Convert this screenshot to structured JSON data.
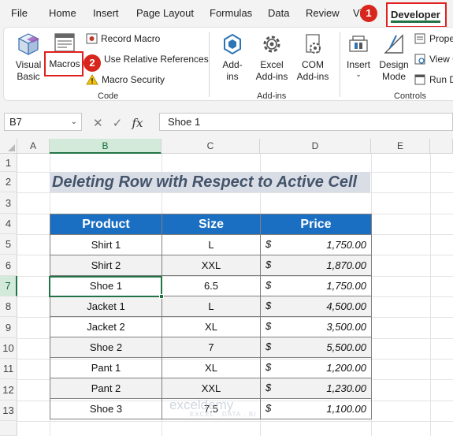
{
  "menu": {
    "tabs": [
      "File",
      "Home",
      "Insert",
      "Page Layout",
      "Formulas",
      "Data",
      "Review",
      "Vi"
    ],
    "developer": "Developer"
  },
  "ribbon": {
    "code": {
      "visual_basic": "Visual\nBasic",
      "macros": "Macros",
      "record_macro": "Record Macro",
      "use_relative": "Use Relative References",
      "macro_security": "Macro Security",
      "label": "Code"
    },
    "addins": {
      "addins": "Add-\nins",
      "excel_addins": "Excel\nAdd-ins",
      "com_addins": "COM\nAdd-ins",
      "label": "Add-ins"
    },
    "controls": {
      "insert": "Insert",
      "design_mode": "Design\nMode",
      "properties": "Prope",
      "view_code": "View C",
      "run_dialog": "Run D",
      "label": "Controls"
    }
  },
  "badges": {
    "one": "1",
    "two": "2"
  },
  "formula_bar": {
    "name_box": "B7",
    "fx": "fx",
    "formula": "Shoe 1"
  },
  "grid": {
    "columns": [
      "A",
      "B",
      "C",
      "D",
      "E"
    ],
    "rows": [
      "1",
      "2",
      "3",
      "4",
      "5",
      "6",
      "7",
      "8",
      "9",
      "10",
      "11",
      "12",
      "13"
    ]
  },
  "sheet": {
    "title": "Deleting Row with Respect to Active Cell",
    "headers": [
      "Product",
      "Size",
      "Price"
    ],
    "currency": "$",
    "rows": [
      {
        "product": "Shirt 1",
        "size": "L",
        "price": "1,750.00"
      },
      {
        "product": "Shirt 2",
        "size": "XXL",
        "price": "1,870.00"
      },
      {
        "product": "Shoe 1",
        "size": "6.5",
        "price": "1,750.00"
      },
      {
        "product": "Jacket 1",
        "size": "L",
        "price": "4,500.00"
      },
      {
        "product": "Jacket 2",
        "size": "XL",
        "price": "3,500.00"
      },
      {
        "product": "Shoe 2",
        "size": "7",
        "price": "5,500.00"
      },
      {
        "product": "Pant 1",
        "size": "XL",
        "price": "1,200.00"
      },
      {
        "product": "Pant 2",
        "size": "XXL",
        "price": "1,230.00"
      },
      {
        "product": "Shoe 3",
        "size": "7.5",
        "price": "1,100.00"
      }
    ]
  },
  "watermark": {
    "name": "exceldemy",
    "tagline": "EXCEL · DATA · BI"
  },
  "colors": {
    "accent_green": "#217346",
    "header_blue": "#1a6fc2",
    "highlight_red": "#e0201f",
    "title_text": "#44546a"
  }
}
